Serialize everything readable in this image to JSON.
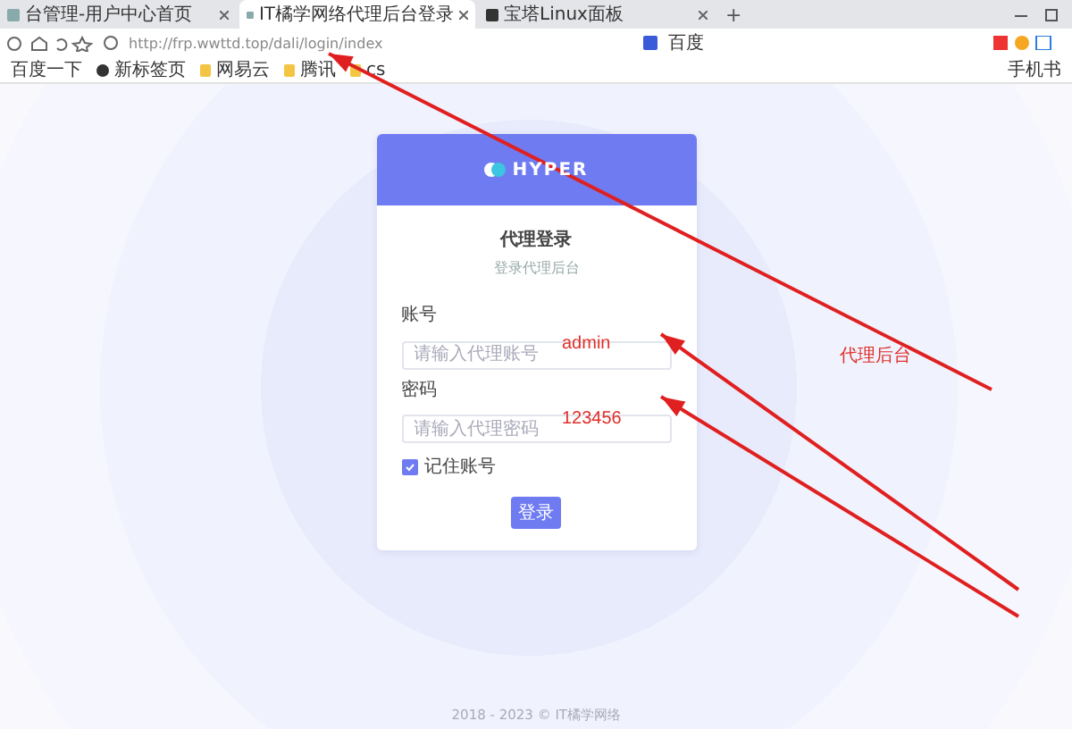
{
  "browser": {
    "tabs": [
      {
        "title": "台管理-用户中心首页",
        "selected": false
      },
      {
        "title": "IT橘学网络代理后台登录",
        "selected": true
      },
      {
        "title": "宝塔Linux面板",
        "selected": false
      }
    ],
    "new_tab": "+",
    "url": "http://frp.wwttd.top/dali/login/index",
    "search_engine": "百度",
    "bookmarks": [
      {
        "label": "百度一下",
        "kind": "plain"
      },
      {
        "label": "新标签页",
        "kind": "site"
      },
      {
        "label": "网易云",
        "kind": "folder"
      },
      {
        "label": "腾讯",
        "kind": "folder"
      },
      {
        "label": "cs",
        "kind": "folder"
      }
    ],
    "mobile_bookmark": "手机书"
  },
  "login": {
    "logo": "HYPER",
    "title": "代理登录",
    "subtitle": "登录代理后台",
    "fields": [
      {
        "label": "账号",
        "placeholder": "请输入代理账号",
        "annotation": "admin"
      },
      {
        "label": "密码",
        "placeholder": "请输入代理密码",
        "annotation": "123456"
      }
    ],
    "remember": {
      "label": "记住账号",
      "checked": true
    },
    "submit": "登录"
  },
  "footer": "2018 - 2023 © IT橘学网络",
  "side_annotation": "代理后台"
}
